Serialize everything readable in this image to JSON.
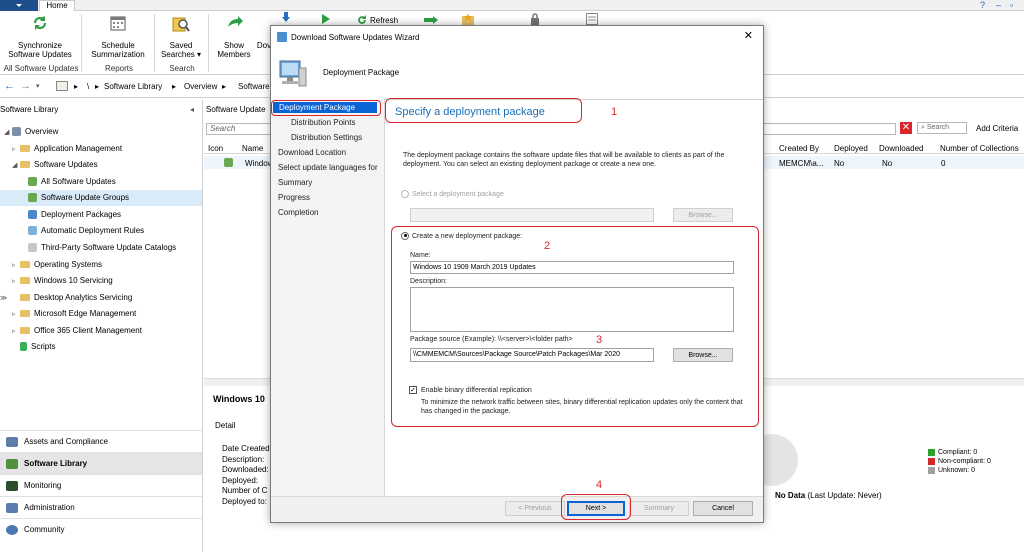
{
  "ribbon": {
    "home_tab": "Home",
    "buttons": {
      "synchronize": [
        "Synchronize",
        "Software Updates"
      ],
      "schedule": [
        "Schedule",
        "Summarization"
      ],
      "saved": [
        "Saved",
        "Searches ▾"
      ],
      "show": [
        "Show",
        "Members"
      ],
      "dow": "Dov"
    },
    "groups": {
      "all_updates": "All Software Updates",
      "reports": "Reports",
      "search": "Search"
    },
    "refresh": "Refresh"
  },
  "address": {
    "crumbs": [
      "\\",
      "Software Library",
      "Overview",
      "Software"
    ]
  },
  "left": {
    "title": "Software Library",
    "tree": [
      {
        "label": "Overview",
        "level": 0
      },
      {
        "label": "Application Management",
        "level": 1
      },
      {
        "label": "Software Updates",
        "level": 1
      },
      {
        "label": "All Software Updates",
        "level": 2
      },
      {
        "label": "Software Update Groups",
        "level": 2
      },
      {
        "label": "Deployment Packages",
        "level": 2
      },
      {
        "label": "Automatic Deployment Rules",
        "level": 2
      },
      {
        "label": "Third-Party Software Update Catalogs",
        "level": 2
      },
      {
        "label": "Operating Systems",
        "level": 1
      },
      {
        "label": "Windows 10 Servicing",
        "level": 1
      },
      {
        "label": "Desktop Analytics Servicing",
        "level": 1
      },
      {
        "label": "Microsoft Edge Management",
        "level": 1
      },
      {
        "label": "Office 365 Client Management",
        "level": 1
      },
      {
        "label": "Scripts",
        "level": 1
      }
    ],
    "workspaces": [
      "Assets and Compliance",
      "Software Library",
      "Monitoring",
      "Administration",
      "Community"
    ]
  },
  "main": {
    "panel_title": "Software Update",
    "search_placeholder": "Search",
    "search_btn": "Search",
    "add_criteria": "Add Criteria",
    "columns": [
      "Icon",
      "Name",
      "Created By",
      "Deployed",
      "Downloaded",
      "Number of Collections"
    ],
    "row": {
      "name": "Window",
      "created_by": "MEMCM\\a...",
      "deployed": "No",
      "downloaded": "No",
      "collections": "0"
    },
    "detail_title": "Windows 10",
    "detail_tab": "Detail",
    "detail_fields": [
      "Date Created",
      "Description:",
      "Downloaded:",
      "Deployed:",
      "Number of C",
      "Deployed to:"
    ],
    "legend": [
      {
        "label": "Compliant: 0",
        "color": "#2ca02c"
      },
      {
        "label": "Non-compliant: 0",
        "color": "#d62728"
      },
      {
        "label": "Unknown: 0",
        "color": "#a0a0a0"
      }
    ],
    "no_data": "No Data",
    "last_update": "(Last Update: Never)"
  },
  "dialog": {
    "title": "Download Software Updates Wizard",
    "header": "Deployment Package",
    "steps": [
      {
        "label": "Deployment Package",
        "sub": false
      },
      {
        "label": "Distribution Points",
        "sub": true
      },
      {
        "label": "Distribution Settings",
        "sub": true
      },
      {
        "label": "Download Location",
        "sub": false
      },
      {
        "label": "Select update languages for",
        "sub": false
      },
      {
        "label": "Summary",
        "sub": false
      },
      {
        "label": "Progress",
        "sub": false
      },
      {
        "label": "Completion",
        "sub": false
      }
    ],
    "page_heading": "Specify a deployment package",
    "description": "The deployment package contains the software update files that will be available to clients as part of the deployment.  You can select an existing deployment package or create a new one.",
    "select_existing": "Select a deployment package",
    "browse": "Browse...",
    "create_new": "Create a new deployment package:",
    "name_label": "Name:",
    "name_value": "Windows 10 1909 March 2019 Updates",
    "description_label": "Description:",
    "package_source_label": "Package source (Example): \\\\<server>\\<folder path>",
    "package_source_value": "\\\\CMMEMCM\\Sources\\Package Source\\Patch Packages\\Mar 2020",
    "binary_diff_label": "Enable binary differential replication",
    "binary_diff_checked": true,
    "binary_diff_help": "To minimize the network traffic between sites, binary differential replication updates only the content that has changed in the package.",
    "buttons": {
      "previous": "< Previous",
      "next": "Next >",
      "summary": "Summary",
      "cancel": "Cancel"
    }
  },
  "annotations": [
    "1",
    "2",
    "3",
    "4"
  ]
}
